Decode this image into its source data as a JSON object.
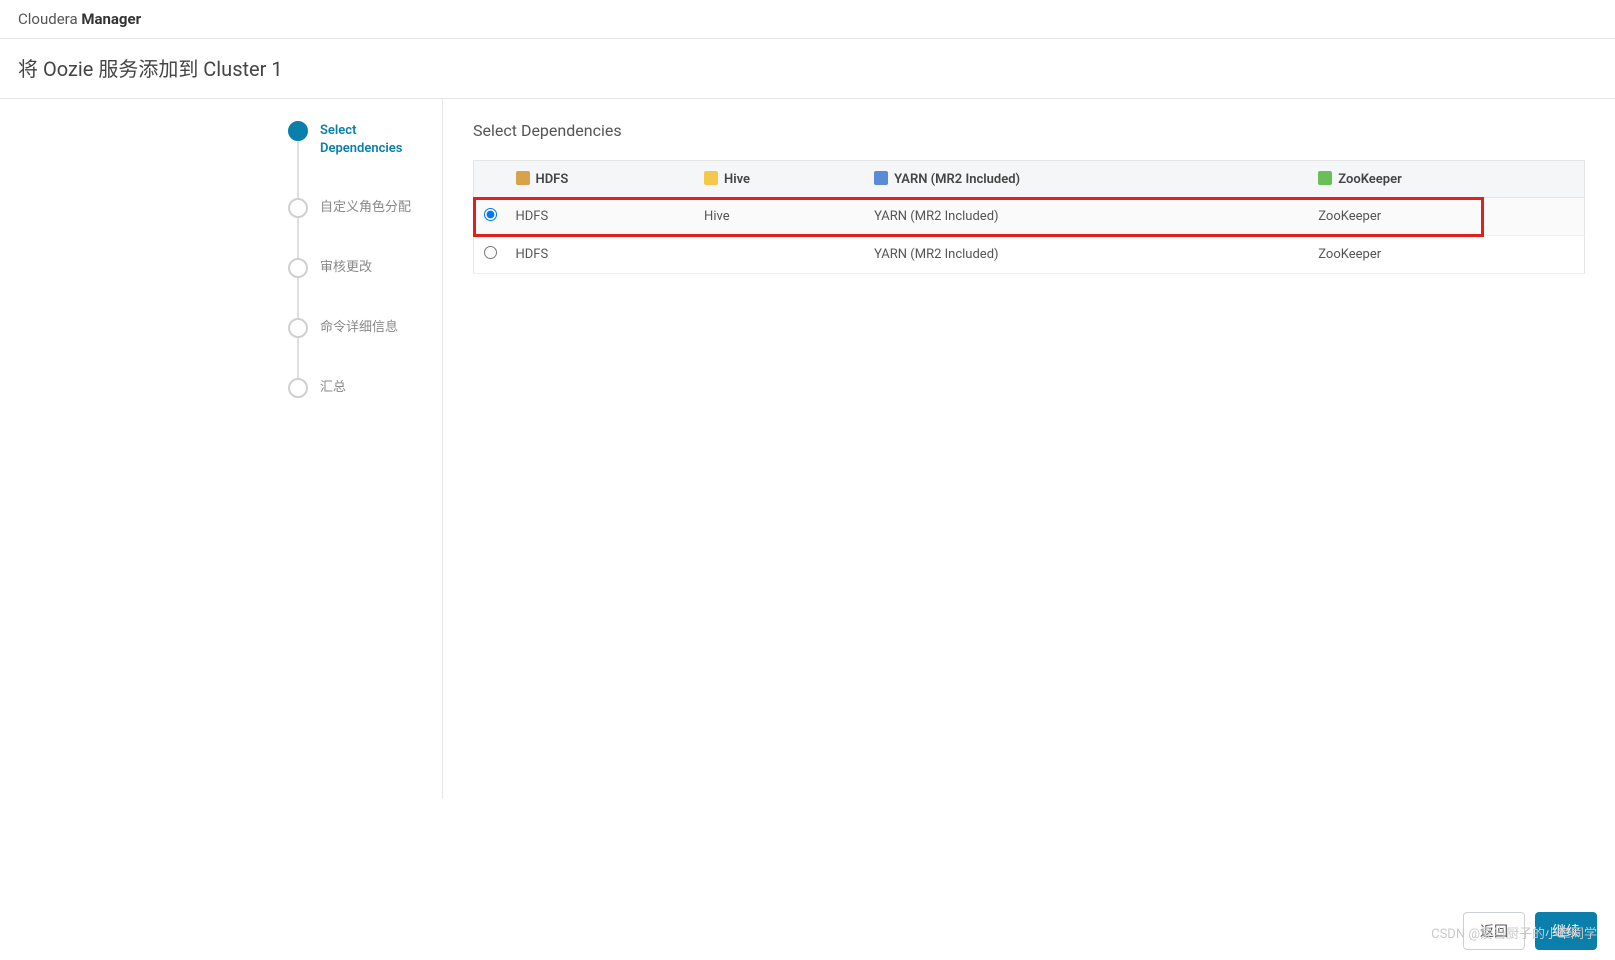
{
  "brand": {
    "light": "Cloudera ",
    "bold": "Manager"
  },
  "page_title": "将 Oozie 服务添加到 Cluster 1",
  "wizard": {
    "steps": [
      {
        "label": "Select Dependencies",
        "active": true
      },
      {
        "label": "自定义角色分配",
        "active": false
      },
      {
        "label": "审核更改",
        "active": false
      },
      {
        "label": "命令详细信息",
        "active": false
      },
      {
        "label": "汇总",
        "active": false
      }
    ]
  },
  "content": {
    "section_title": "Select Dependencies",
    "columns": [
      {
        "label": "HDFS",
        "icon": "ic-hdfs"
      },
      {
        "label": "Hive",
        "icon": "ic-hive"
      },
      {
        "label": "YARN (MR2 Included)",
        "icon": "ic-yarn"
      },
      {
        "label": "ZooKeeper",
        "icon": "ic-zk"
      }
    ],
    "rows": [
      {
        "selected": true,
        "highlight": true,
        "cells": [
          "HDFS",
          "Hive",
          "YARN (MR2 Included)",
          "ZooKeeper"
        ]
      },
      {
        "selected": false,
        "highlight": false,
        "cells": [
          "HDFS",
          "",
          "YARN (MR2 Included)",
          "ZooKeeper"
        ]
      }
    ]
  },
  "footer": {
    "back": "返回",
    "next": "继续"
  },
  "watermark": "CSDN @爱当厨子的小章同学"
}
